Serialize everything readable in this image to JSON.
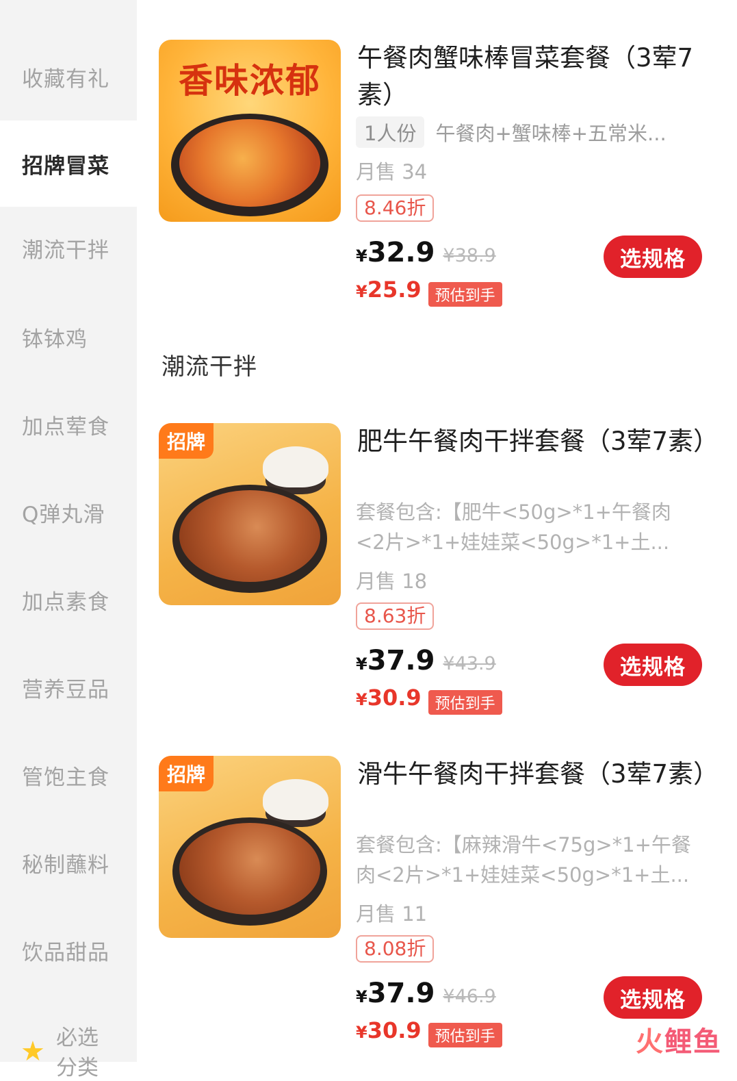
{
  "sidebar": {
    "items": [
      {
        "label": "收藏有礼"
      },
      {
        "label": "招牌冒菜"
      },
      {
        "label": "潮流干拌"
      },
      {
        "label": "钵钵鸡"
      },
      {
        "label": "加点荤食"
      },
      {
        "label": "Q弹丸滑"
      },
      {
        "label": "加点素食"
      },
      {
        "label": "营养豆品"
      },
      {
        "label": "管饱主食"
      },
      {
        "label": "秘制蘸料"
      },
      {
        "label": "饮品甜品"
      }
    ],
    "active_index": 1,
    "special": {
      "label": "必选",
      "label2": "分类",
      "icon": "star-icon"
    }
  },
  "section": {
    "title": "潮流干拌"
  },
  "products": [
    {
      "image_text": "香味浓郁",
      "title": "午餐肉蟹味棒冒菜套餐（3荤7素）",
      "spec_pill": "1人份",
      "spec_text": "午餐肉+蟹味棒+五常米...",
      "sales": "月售 34",
      "discount": "8.46折",
      "currency": "¥",
      "price": "32.9",
      "original_price": "¥38.9",
      "final_price": "25.9",
      "final_badge": "预估到手",
      "button": "选规格"
    },
    {
      "tag": "招牌",
      "title": "肥牛午餐肉干拌套餐（3荤7素）",
      "desc": "套餐包含:【肥牛<50g>*1+午餐肉<2片>*1+娃娃菜<50g>*1+土...",
      "sales": "月售 18",
      "discount": "8.63折",
      "currency": "¥",
      "price": "37.9",
      "original_price": "¥43.9",
      "final_price": "30.9",
      "final_badge": "预估到手",
      "button": "选规格"
    },
    {
      "tag": "招牌",
      "title": "滑牛午餐肉干拌套餐（3荤7素）",
      "desc": "套餐包含:【麻辣滑牛<75g>*1+午餐肉<2片>*1+娃娃菜<50g>*1+土...",
      "sales": "月售 11",
      "discount": "8.08折",
      "currency": "¥",
      "price": "37.9",
      "original_price": "¥46.9",
      "final_price": "30.9",
      "final_badge": "预估到手",
      "button": "选规格"
    }
  ],
  "watermark": {
    "part1": "火",
    "part2": "鲤鱼"
  },
  "colors": {
    "accent_red": "#e1222a",
    "tag_orange": "#ff7a1a",
    "price_red": "#e8362a"
  }
}
